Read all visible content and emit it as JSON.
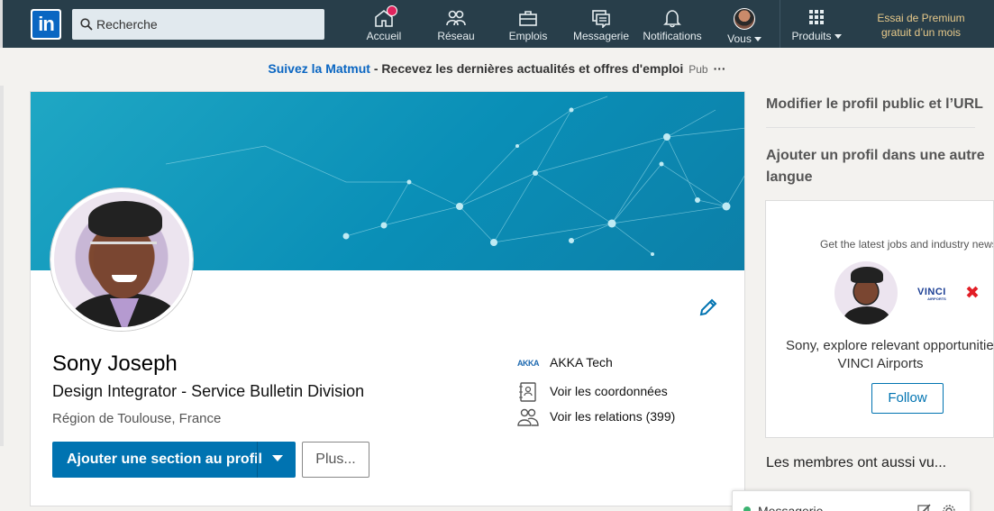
{
  "nav": {
    "search_placeholder": "Recherche",
    "items": [
      {
        "label": "Accueil",
        "icon": "home-icon"
      },
      {
        "label": "Réseau",
        "icon": "network-icon"
      },
      {
        "label": "Emplois",
        "icon": "briefcase-icon"
      },
      {
        "label": "Messagerie",
        "icon": "messaging-icon"
      },
      {
        "label": "Notifications",
        "icon": "bell-icon"
      },
      {
        "label": "Vous",
        "icon": "avatar"
      },
      {
        "label": "Produits",
        "icon": "grid-icon"
      }
    ],
    "premium_line1": "Essai de Premium",
    "premium_line2": "gratuit d’un mois",
    "colors": {
      "bar": "#283e4a",
      "premium": "#e7c98a",
      "brand": "#0a66c2"
    }
  },
  "ad": {
    "link": "Suivez la Matmut",
    "text": " - Recevez les dernières actualités et offres d'emploi",
    "pub": "Pub",
    "more": "···"
  },
  "profile": {
    "name": "Sony Joseph",
    "headline": "Design Integrator - Service Bulletin Division",
    "location": "Région de Toulouse, France",
    "add_section": "Ajouter une section au profil",
    "more": "Plus...",
    "company_logo": "AKKA",
    "company": "AKKA Tech",
    "contact": "Voir les coordonnées",
    "connections": "Voir les relations (399)"
  },
  "right": {
    "edit_public": "Modifier le profil public et l’URL",
    "add_language_1": "Ajouter un profil dans une autre",
    "add_language_2": "langue",
    "ad_tag": "Get the latest jobs and industry news",
    "ad_brand": "VINCI",
    "ad_brand_small": "AIRPORTS",
    "ad_message": "Sony, explore relevant opportunities",
    "ad_company": "VINCI Airports",
    "follow": "Follow",
    "members": "Les membres ont aussi vu..."
  },
  "messaging": {
    "label": "Messagerie",
    "status_color": "#3cb371"
  }
}
